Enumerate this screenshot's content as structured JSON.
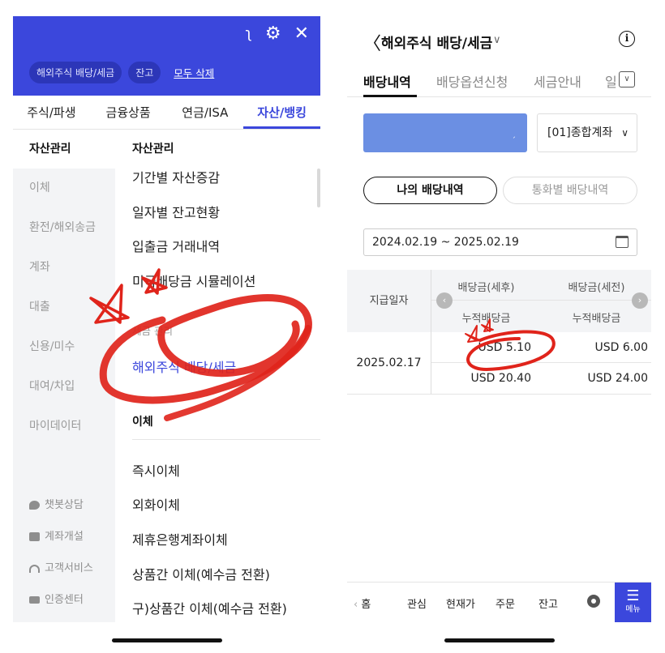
{
  "left": {
    "header": {
      "chips": [
        "해외주식 배당/세금",
        "잔고"
      ],
      "delete_all": "모두 삭제"
    },
    "tabs": [
      "주식/파생",
      "금융상품",
      "연금/ISA",
      "자산/뱅킹"
    ],
    "active_tab": 3,
    "sidebar": {
      "title": "자산관리",
      "items": [
        "이체",
        "환전/해외송금",
        "계좌",
        "대출",
        "신용/미수",
        "대여/차입",
        "마이데이터"
      ],
      "bottom": [
        "챗봇상담",
        "계좌개설",
        "고객서비스",
        "인증센터"
      ]
    },
    "main": {
      "title": "자산관리",
      "items": [
        "기간별 자산증감",
        "일자별 잔고현황",
        "입출금 거래내역",
        "미국배당금 시뮬레이션"
      ],
      "sub_header": "세금 관리",
      "active_item": "해외주식 배당/세금",
      "section2_title": "이체",
      "section2_items": [
        "즉시이체",
        "외화이체",
        "제휴은행계좌이체",
        "상품간 이체(예수금 전환)",
        "구)상품간 이체(예수금 전환)"
      ]
    }
  },
  "right": {
    "title": "해외주식 배당/세금",
    "tabs": [
      "배당내역",
      "배당옵션신청",
      "세금안내",
      "일"
    ],
    "account_select": "[01]종합계좌",
    "segments": [
      "나의 배당내역",
      "통화별 배당내역"
    ],
    "date_range": "2024.02.19 ~ 2025.02.19",
    "table": {
      "date_header": "지급일자",
      "col1_header": "배당금(세후)",
      "col2_header": "배당금(세전)",
      "sub_header": "누적배당금",
      "row_date": "2025.02.17",
      "row1": [
        "USD 5.10",
        "USD 6.00"
      ],
      "row2": [
        "USD 20.40",
        "USD 24.00"
      ]
    },
    "bottom_nav": {
      "home": "홈",
      "items": [
        "관심",
        "현재가",
        "주문",
        "잔고"
      ],
      "menu": "메뉴"
    }
  },
  "colors": {
    "brand_blue": "#3b47dc",
    "annotation_red": "#e0241b",
    "account_blue": "#6b8fe3"
  }
}
